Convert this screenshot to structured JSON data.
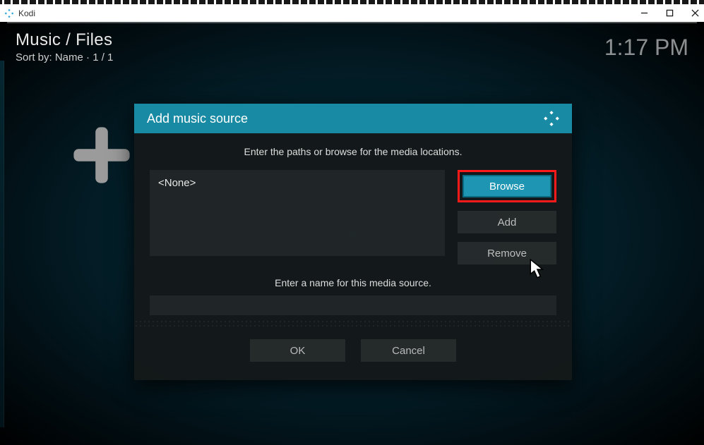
{
  "app": {
    "name": "Kodi"
  },
  "header": {
    "breadcrumb": "Music / Files",
    "sort_line": "Sort by: Name  ·  1 / 1",
    "clock": "1:17 PM"
  },
  "dialog": {
    "title": "Add music source",
    "instruction": "Enter the paths or browse for the media locations.",
    "path_placeholder": "<None>",
    "browse": "Browse",
    "add": "Add",
    "remove": "Remove",
    "name_instruction": "Enter a name for this media source.",
    "name_value": "",
    "ok": "OK",
    "cancel": "Cancel"
  }
}
